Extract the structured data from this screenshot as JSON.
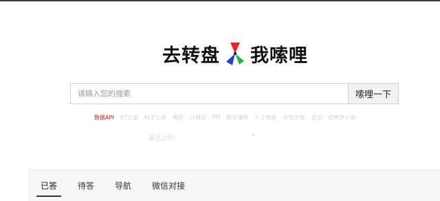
{
  "logo": {
    "text_left": "去转盘",
    "text_right": "我嗦哩",
    "mark_colors": [
      "#e8232a",
      "#1f3fd6",
      "#22b14c"
    ]
  },
  "search": {
    "placeholder": "请输入您的搜索",
    "value": "",
    "button_label": "嗦哩一下"
  },
  "quick_links": [
    {
      "label": "数据API",
      "active": true
    },
    {
      "label": "BT之家",
      "active": false
    },
    {
      "label": "科学上网",
      "active": false
    },
    {
      "label": "电影",
      "active": false
    },
    {
      "label": "计算机",
      "active": false
    },
    {
      "label": "FM",
      "active": false
    },
    {
      "label": "数学课件",
      "active": false
    },
    {
      "label": "人工智能",
      "active": false
    },
    {
      "label": "天空之城",
      "active": false
    },
    {
      "label": "史记",
      "active": false
    },
    {
      "label": "红楼梦小说",
      "active": false
    }
  ],
  "status": {
    "last_online": "最近上线：",
    "dot": "•"
  },
  "tabs": [
    {
      "label": "已答",
      "active": true
    },
    {
      "label": "待答",
      "active": false
    },
    {
      "label": "导航",
      "active": false
    },
    {
      "label": "微信对接",
      "active": false
    }
  ]
}
